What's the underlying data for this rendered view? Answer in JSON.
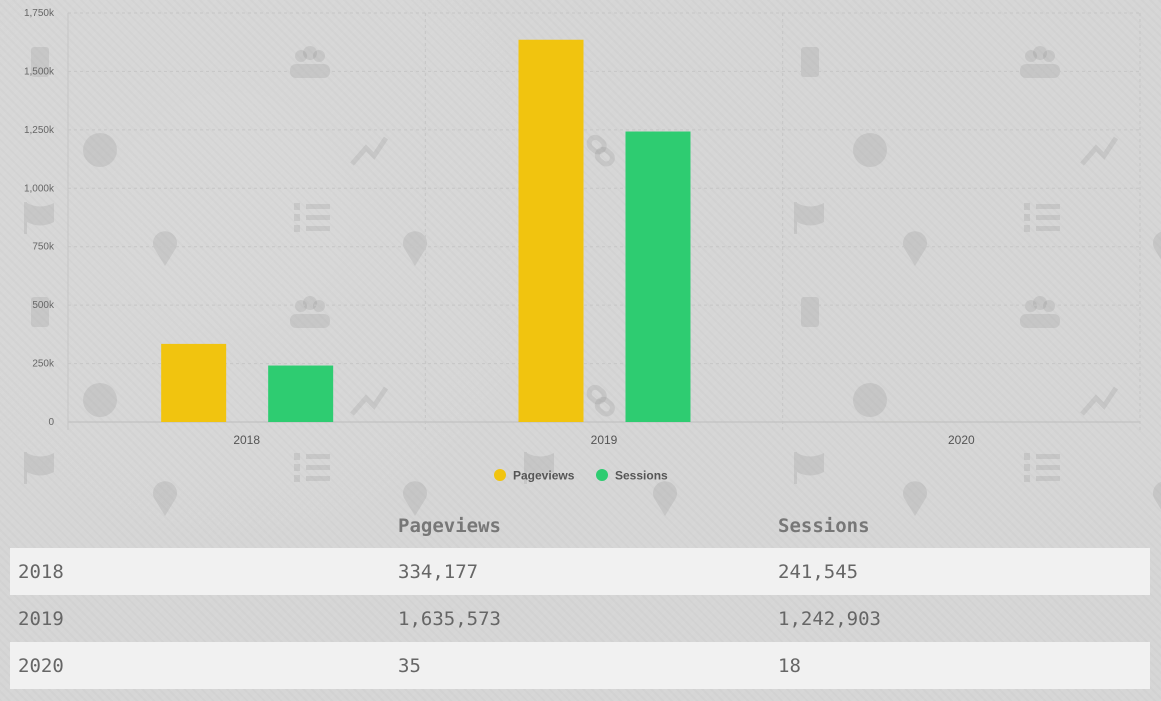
{
  "chart_data": {
    "type": "bar",
    "categories": [
      "2018",
      "2019",
      "2020"
    ],
    "series": [
      {
        "name": "Pageviews",
        "values": [
          334177,
          1635573,
          35
        ],
        "color": "#f1c40f"
      },
      {
        "name": "Sessions",
        "values": [
          241545,
          1242903,
          18
        ],
        "color": "#2ecc71"
      }
    ],
    "ylim": [
      0,
      1750000
    ],
    "yticks": [
      0,
      250000,
      500000,
      750000,
      1000000,
      1250000,
      1500000,
      1750000
    ],
    "ytick_labels": [
      "0",
      "250k",
      "500k",
      "750k",
      "1,000k",
      "1,250k",
      "1,500k",
      "1,750k"
    ],
    "grid": true,
    "legend": "bottom-center",
    "title": "",
    "xlabel": "",
    "ylabel": ""
  },
  "table": {
    "headers": [
      "",
      "Pageviews",
      "Sessions"
    ],
    "rows": [
      [
        "2018",
        "334,177",
        "241,545"
      ],
      [
        "2019",
        "1,635,573",
        "1,242,903"
      ],
      [
        "2020",
        "35",
        "18"
      ]
    ]
  }
}
